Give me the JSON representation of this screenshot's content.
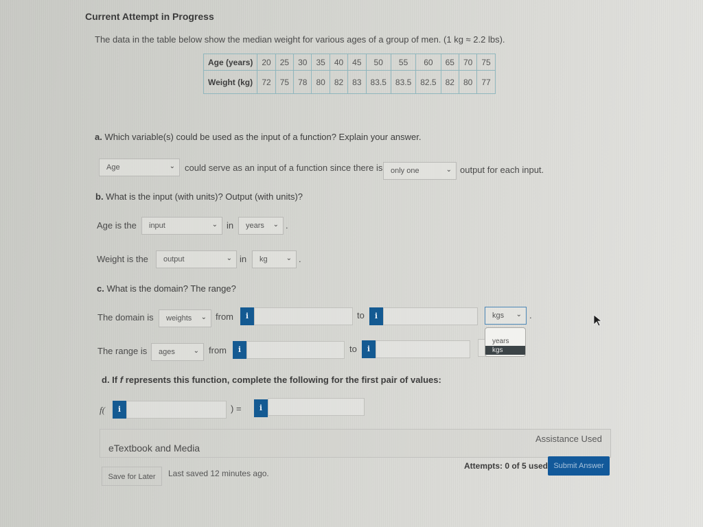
{
  "header": {
    "title": "Current Attempt in Progress"
  },
  "intro": "The data in the table below show the median weight for various ages of a group of men. (1 kg  ≈  2.2 lbs).",
  "table": {
    "rows": [
      {
        "label": "Age (years)",
        "values": [
          "20",
          "25",
          "30",
          "35",
          "40",
          "45",
          "50",
          "55",
          "60",
          "65",
          "70",
          "75"
        ]
      },
      {
        "label": "Weight (kg)",
        "values": [
          "72",
          "75",
          "78",
          "80",
          "82",
          "83",
          "83.5",
          "83.5",
          "82.5",
          "82",
          "80",
          "77"
        ]
      }
    ]
  },
  "part_a": {
    "question_letter": "a.",
    "question": " Which variable(s) could be used as the input of a function? Explain your answer.",
    "select_variable": "Age",
    "text_mid": "could serve as an input of a function since there is",
    "select_quantity": "only one",
    "text_end": "output for each input."
  },
  "part_b": {
    "question_letter": "b.",
    "question": " What is the input (with units)? Output (with units)?",
    "row1": {
      "prefix": "Age is the",
      "select_role": "input",
      "in": "in",
      "select_unit": "years",
      "suffix": "."
    },
    "row2": {
      "prefix": "Weight is the",
      "select_role": "output",
      "in": "in",
      "select_unit": "kg",
      "suffix": "."
    }
  },
  "part_c": {
    "question_letter": "c.",
    "question": " What is the domain? The range?",
    "domain": {
      "prefix": "The domain is",
      "select": "weights",
      "from": "from",
      "from_value": "",
      "to": "to",
      "to_value": "",
      "unit_select": "kgs",
      "suffix": "."
    },
    "range": {
      "prefix": "The range is",
      "select": "ages",
      "from": "from",
      "from_value": "",
      "to": "to",
      "to_value": ""
    },
    "open_dropdown_options": [
      "",
      "years",
      "kgs"
    ],
    "open_dropdown_selected": "kgs"
  },
  "part_d": {
    "question_letter": "d.",
    "question_pre": " If ",
    "question_f": "f",
    "question_post": " represents this function, complete the following for the first pair of values:",
    "f_open": "f(",
    "close_equals": ") =",
    "input_value": "",
    "output_value": ""
  },
  "info_icon_glyph": "i",
  "footer": {
    "panel_label": "eTextbook and Media",
    "assistance": "Assistance Used",
    "save_button": "Save for Later",
    "last_saved": "Last saved 12 minutes ago.",
    "attempts": "Attempts: 0 of 5 used",
    "submit_button": "Submit Answer"
  },
  "colors": {
    "accent": "#145a92",
    "table_border": "#8fb6bd"
  }
}
